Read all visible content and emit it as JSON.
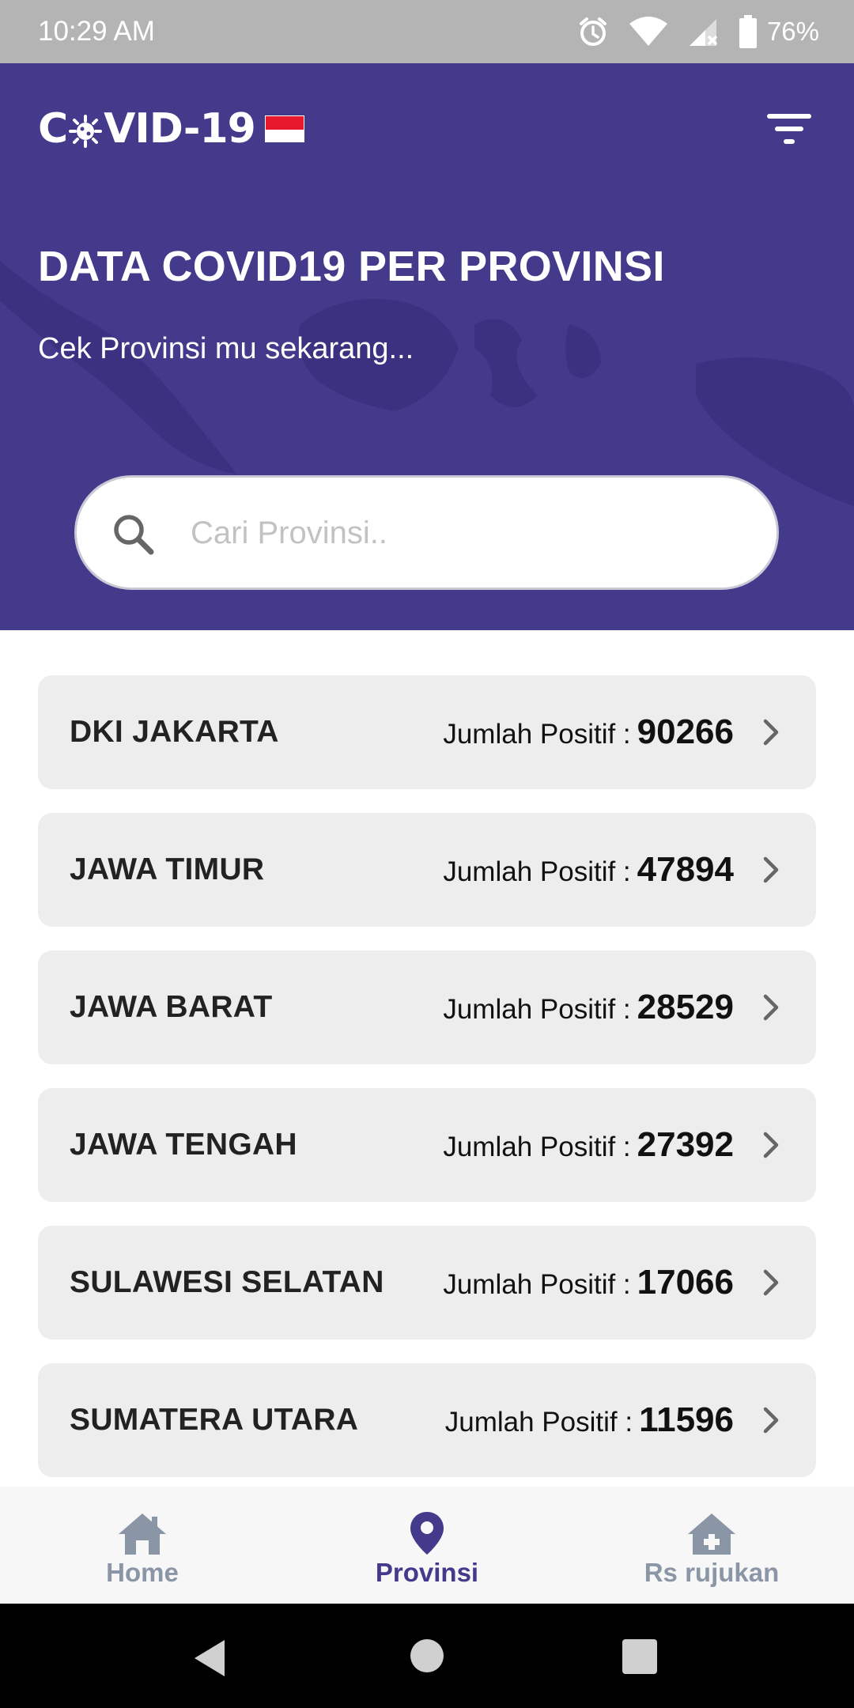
{
  "status_bar": {
    "time": "10:29 AM",
    "battery_percent": "76%",
    "icons": [
      "alarm-icon",
      "wifi-icon",
      "signal-icon",
      "battery-icon"
    ]
  },
  "header": {
    "logo_text_left": "C",
    "logo_text_right": "VID-19",
    "title": "DATA COVID19 PER PROVINSI",
    "subtitle": "Cek Provinsi mu sekarang...",
    "background_color": "#433a8c",
    "menu_icon": "filter-icon"
  },
  "search": {
    "placeholder": "Cari Provinsi..",
    "value": ""
  },
  "provinces": [
    {
      "name": "DKI JAKARTA",
      "label": "Jumlah Positif :",
      "value": "90266"
    },
    {
      "name": "JAWA TIMUR",
      "label": "Jumlah Positif :",
      "value": "47894"
    },
    {
      "name": "JAWA BARAT",
      "label": "Jumlah Positif :",
      "value": "28529"
    },
    {
      "name": "JAWA TENGAH",
      "label": "Jumlah Positif :",
      "value": "27392"
    },
    {
      "name": "SULAWESI SELATAN",
      "label": "Jumlah Positif :",
      "value": "17066"
    },
    {
      "name": "SUMATERA UTARA",
      "label": "Jumlah Positif :",
      "value": "11596"
    }
  ],
  "bottom_nav": {
    "items": [
      {
        "label": "Home",
        "icon": "home-icon",
        "active": false
      },
      {
        "label": "Provinsi",
        "icon": "location-pin-icon",
        "active": true
      },
      {
        "label": "Rs rujukan",
        "icon": "hospital-icon",
        "active": false
      }
    ],
    "active_color": "#433a8c",
    "inactive_color": "#8a96a6"
  }
}
